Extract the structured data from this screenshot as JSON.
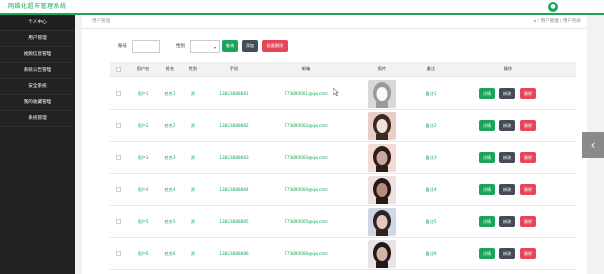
{
  "app": {
    "title": "网络化超市管理系统",
    "user_icon": "user-icon"
  },
  "sidebar": {
    "items": [
      {
        "label": "个人中心"
      },
      {
        "label": "用户管理"
      },
      {
        "label": "视频信息管理"
      },
      {
        "label": "系统公告管理"
      },
      {
        "label": "安全系统"
      },
      {
        "label": "我的收藏管理"
      },
      {
        "label": "系统管理"
      }
    ]
  },
  "breadcrumb": {
    "left": "用户管理",
    "right": "/ 用户管理 / 用户列表"
  },
  "search": {
    "account_label": "账号",
    "account_value": "",
    "gender_label": "性别",
    "gender_value": "",
    "query_button": "查询",
    "add_button": "添加",
    "batch_delete_button": "批量删除"
  },
  "table": {
    "headers": [
      "用户名",
      "姓名",
      "性别",
      "手机",
      "邮箱",
      "照片",
      "备注",
      "操作"
    ],
    "rows": [
      {
        "username": "用户1",
        "name": "姓名1",
        "gender": "男",
        "phone": "13823888881",
        "email": "773890001@qq.com",
        "note": "备注1"
      },
      {
        "username": "用户2",
        "name": "姓名2",
        "gender": "男",
        "phone": "13823888882",
        "email": "773890002@qq.com",
        "note": "备注2"
      },
      {
        "username": "用户3",
        "name": "姓名3",
        "gender": "男",
        "phone": "13823888883",
        "email": "773890003@qq.com",
        "note": "备注3"
      },
      {
        "username": "用户4",
        "name": "姓名4",
        "gender": "男",
        "phone": "13823888884",
        "email": "773890004@qq.com",
        "note": "备注4"
      },
      {
        "username": "用户5",
        "name": "姓名5",
        "gender": "男",
        "phone": "13823888885",
        "email": "773890005@qq.com",
        "note": "备注5"
      },
      {
        "username": "用户6",
        "name": "姓名6",
        "gender": "男",
        "phone": "13823888886",
        "email": "773890006@qq.com",
        "note": "备注6"
      }
    ],
    "actions": {
      "detail": "详情",
      "edit": "修改",
      "delete": "删除"
    }
  },
  "colors": {
    "accent": "#1aa55a",
    "danger": "#e8455a",
    "dark": "#444c59",
    "sidebar": "#222222"
  }
}
